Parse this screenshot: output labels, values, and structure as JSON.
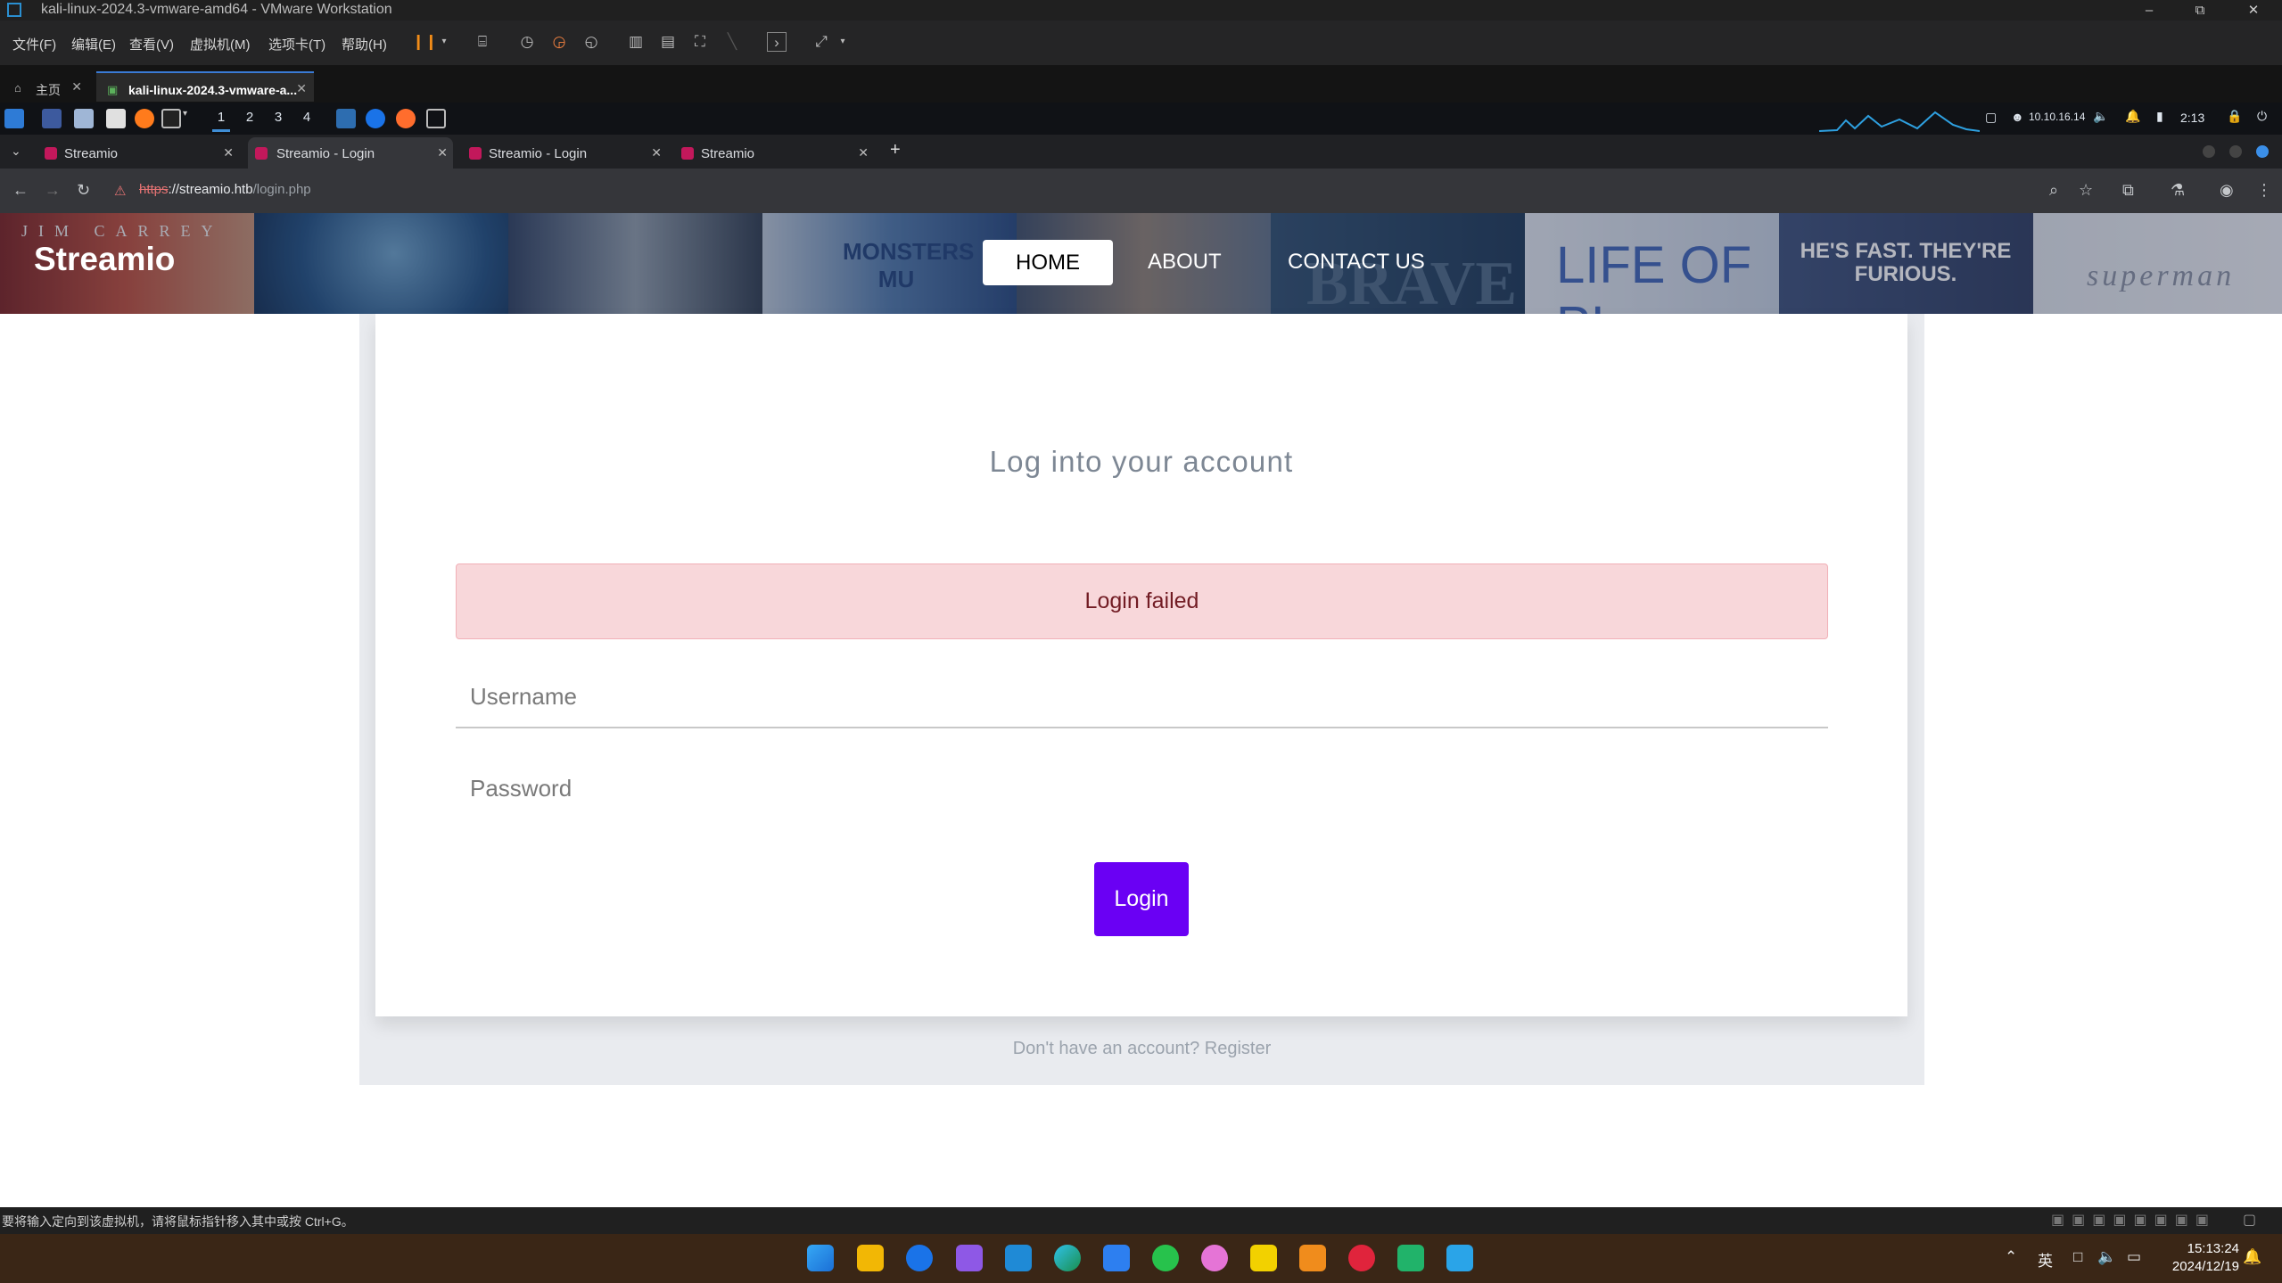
{
  "vmware": {
    "title": "kali-linux-2024.3-vmware-amd64 - VMware Workstation",
    "menu": [
      "文件(F)",
      "编辑(E)",
      "查看(V)",
      "虚拟机(M)",
      "选项卡(T)",
      "帮助(H)"
    ],
    "tabs": [
      {
        "label": "主页",
        "active": false
      },
      {
        "label": "kali-linux-2024.3-vmware-a...",
        "active": true
      }
    ],
    "status_text": "要将输入定向到该虚拟机，请将鼠标指针移入其中或按 Ctrl+G。"
  },
  "kali_panel": {
    "workspaces": [
      "1",
      "2",
      "3",
      "4"
    ],
    "active_workspace": "1",
    "ip": "10.10.16.14",
    "time": "2:13"
  },
  "browser": {
    "tabs": [
      {
        "label": "Streamio",
        "active": false
      },
      {
        "label": "Streamio - Login",
        "active": true
      },
      {
        "label": "Streamio - Login",
        "active": false
      },
      {
        "label": "Streamio",
        "active": false
      }
    ],
    "new_tab": "+",
    "url_scheme": "https",
    "url_host": "://streamio.htb",
    "url_path": "/login.php"
  },
  "site": {
    "brand": "Streamio",
    "nav": {
      "home": "HOME",
      "about": "ABOUT",
      "contact": "CONTACT US"
    },
    "posters": [
      "JIM CARREY",
      "",
      "",
      "MONSTERS MU",
      "",
      "BRAVE",
      "LIFE OF PI",
      "HE'S FAST. THEY'RE FURIOUS.",
      "superman"
    ],
    "login": {
      "title": "Log into your account",
      "alert": "Login failed",
      "username_placeholder": "Username",
      "password_placeholder": "Password",
      "button": "Login",
      "register_text": "Don't have an account? Register"
    }
  },
  "taskbar": {
    "time": "15:13:24",
    "date": "2024/12/19",
    "ime": "英"
  },
  "colors": {
    "accent": "#6a00f4",
    "alert_bg": "#f8d7da",
    "alert_text": "#721c24"
  }
}
